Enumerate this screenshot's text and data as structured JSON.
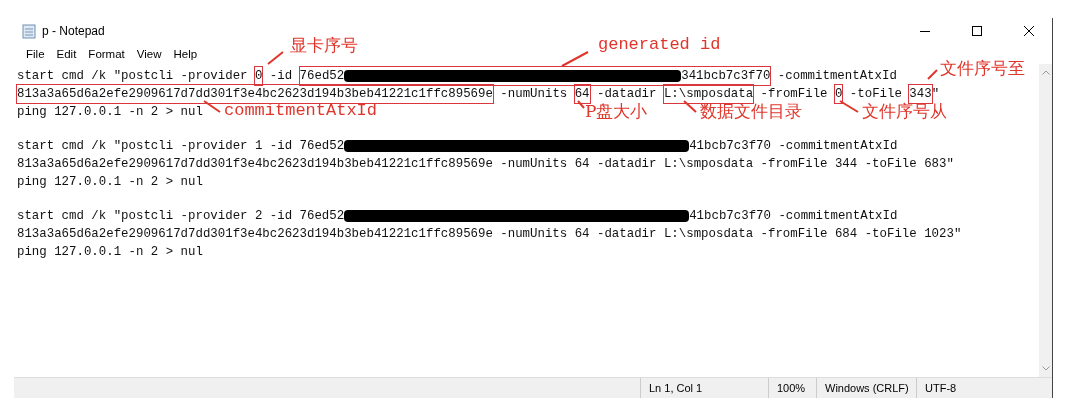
{
  "window": {
    "title": "p - Notepad"
  },
  "menu": [
    "File",
    "Edit",
    "Format",
    "View",
    "Help"
  ],
  "commands": [
    {
      "lines": [
        [
          {
            "kind": "text",
            "text": "start cmd /k \"postcli -provider "
          },
          {
            "kind": "boxed",
            "parts": [
              {
                "kind": "text",
                "text": "0"
              }
            ]
          },
          {
            "kind": "text",
            "text": " -id "
          },
          {
            "kind": "boxed",
            "parts": [
              {
                "kind": "text",
                "text": "76ed52"
              },
              {
                "kind": "redacted"
              },
              {
                "kind": "text",
                "text": "341bcb7c3f70"
              }
            ]
          },
          {
            "kind": "text",
            "text": " -commitmentAtxId"
          }
        ],
        [
          {
            "kind": "boxed",
            "parts": [
              {
                "kind": "text",
                "text": "813a3a65d6a2efe2909617d7dd301f3e4bc2623d194b3beb41221c1ffc89569e"
              }
            ]
          },
          {
            "kind": "text",
            "text": " -numUnits "
          },
          {
            "kind": "boxed",
            "parts": [
              {
                "kind": "text",
                "text": "64"
              }
            ]
          },
          {
            "kind": "text",
            "text": " -datadir "
          },
          {
            "kind": "boxed",
            "parts": [
              {
                "kind": "text",
                "text": "L:\\smposdata"
              }
            ]
          },
          {
            "kind": "text",
            "text": " -fromFile "
          },
          {
            "kind": "boxed",
            "parts": [
              {
                "kind": "text",
                "text": "0"
              }
            ]
          },
          {
            "kind": "text",
            "text": " -toFile "
          },
          {
            "kind": "boxed",
            "parts": [
              {
                "kind": "text",
                "text": "343"
              }
            ]
          },
          {
            "kind": "text",
            "text": "\""
          }
        ],
        [
          {
            "kind": "text",
            "text": "ping 127.0.0.1 -n 2 > nul"
          }
        ]
      ]
    },
    {
      "lines": [
        [
          {
            "kind": "text",
            "text": "start cmd /k \"postcli -provider 1 -id 76ed52"
          },
          {
            "kind": "redacted"
          },
          {
            "kind": "text",
            "text": "41bcb7c3f70 -commitmentAtxId"
          }
        ],
        [
          {
            "kind": "text",
            "text": "813a3a65d6a2efe2909617d7dd301f3e4bc2623d194b3beb41221c1ffc89569e -numUnits 64 -datadir L:\\smposdata -fromFile 344 -toFile 683\""
          }
        ],
        [
          {
            "kind": "text",
            "text": "ping 127.0.0.1 -n 2 > nul"
          }
        ]
      ]
    },
    {
      "lines": [
        [
          {
            "kind": "text",
            "text": "start cmd /k \"postcli -provider 2 -id 76ed52"
          },
          {
            "kind": "redacted"
          },
          {
            "kind": "text",
            "text": "41bcb7c3f70 -commitmentAtxId"
          }
        ],
        [
          {
            "kind": "text",
            "text": "813a3a65d6a2efe2909617d7dd301f3e4bc2623d194b3beb41221c1ffc89569e -numUnits 64 -datadir L:\\smposdata -fromFile 684 -toFile 1023\""
          }
        ],
        [
          {
            "kind": "text",
            "text": "ping 127.0.0.1 -n 2 > nul"
          }
        ]
      ]
    }
  ],
  "annotations": [
    {
      "label": "显卡序号"
    },
    {
      "label": "generated id"
    },
    {
      "label": "文件序号至"
    },
    {
      "label": "commitmentAtxId"
    },
    {
      "label": "P盘大小"
    },
    {
      "label": "数据文件目录"
    },
    {
      "label": "文件序号从"
    }
  ],
  "status_bar": [
    "Ln 1, Col 1",
    "100%",
    "Windows (CRLF)",
    "UTF-8"
  ]
}
